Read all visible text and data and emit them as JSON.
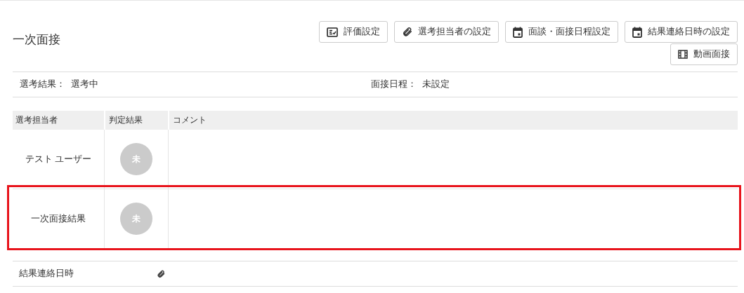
{
  "title": "一次面接",
  "buttons": [
    {
      "kind": "evaluation",
      "label": "評価設定"
    },
    {
      "kind": "clip",
      "label": "選考担当者の設定"
    },
    {
      "kind": "calendar",
      "label": "面談・面接日程設定"
    },
    {
      "kind": "calendar",
      "label": "結果連絡日時の設定"
    },
    {
      "kind": "film",
      "label": "動画面接"
    }
  ],
  "info": [
    {
      "label": "選考結果：",
      "value": "選考中"
    },
    {
      "label": "面接日程：",
      "value": "未設定"
    }
  ],
  "table": {
    "columns": [
      "選考担当者",
      "判定結果",
      "コメント"
    ],
    "rows": [
      {
        "name": "テスト ユーザー",
        "result": "未",
        "highlighted": false
      },
      {
        "name": "一次面接結果",
        "result": "未",
        "highlighted": true
      }
    ]
  },
  "footer": {
    "label": "結果連絡日時"
  }
}
